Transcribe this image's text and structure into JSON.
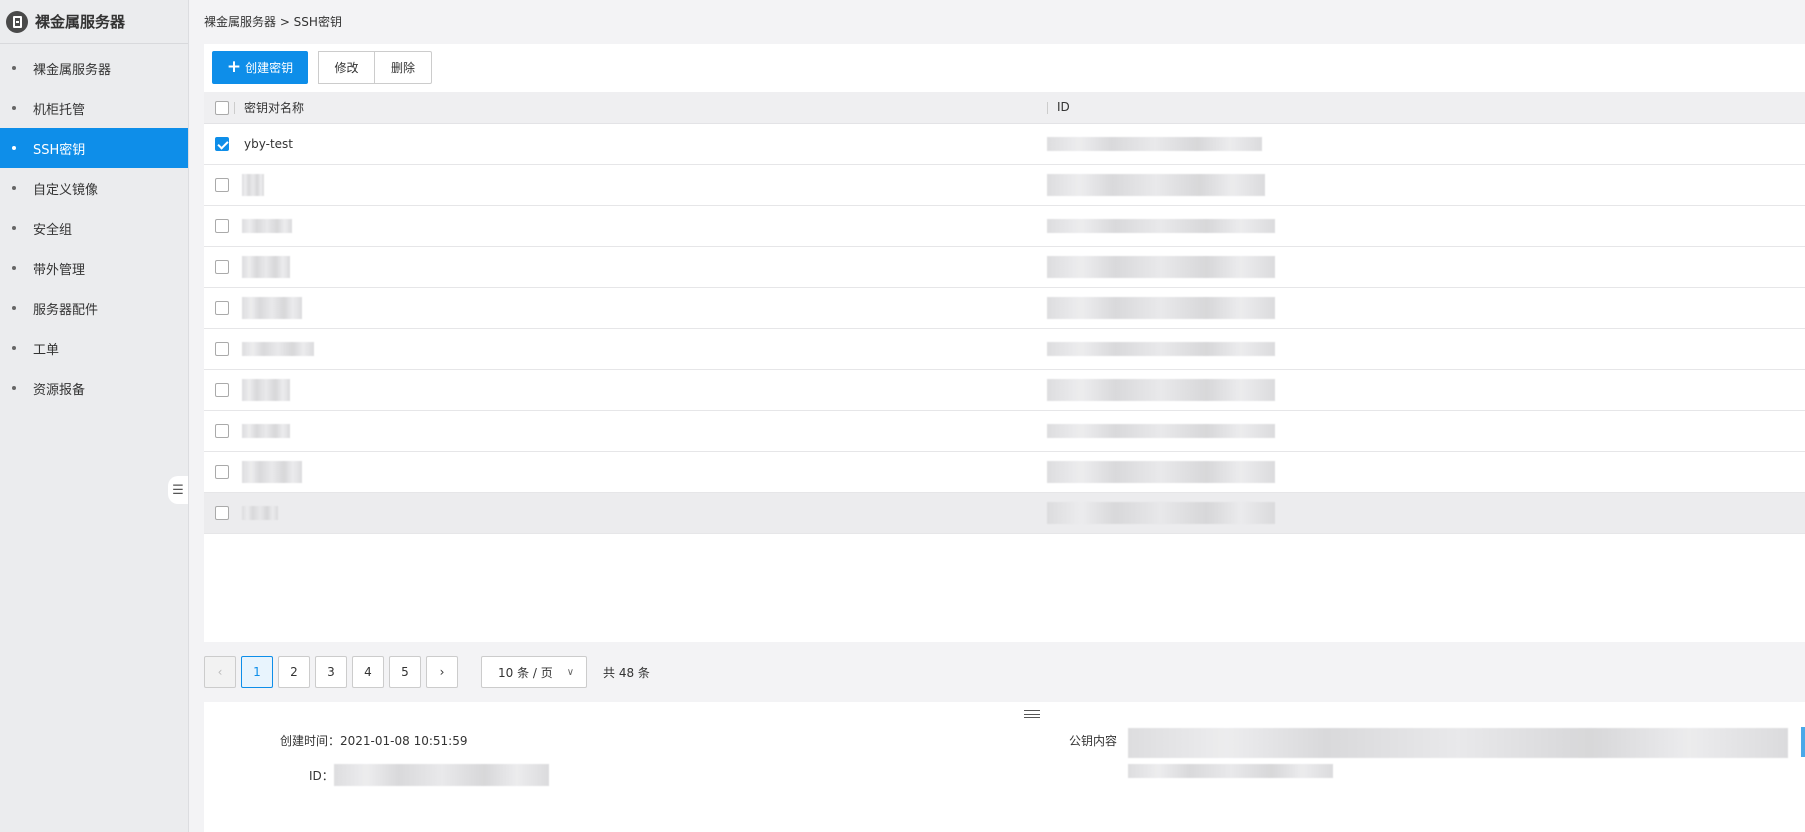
{
  "sidebar": {
    "title": "裸金属服务器",
    "items": [
      {
        "label": "裸金属服务器"
      },
      {
        "label": "机柜托管"
      },
      {
        "label": "SSH密钥"
      },
      {
        "label": "自定义镜像"
      },
      {
        "label": "安全组"
      },
      {
        "label": "带外管理"
      },
      {
        "label": "服务器配件"
      },
      {
        "label": "工单"
      },
      {
        "label": "资源报备"
      }
    ],
    "active_index": 2,
    "collapse_icon": "list-collapse-icon"
  },
  "breadcrumb": "裸金属服务器 > SSH密钥",
  "toolbar": {
    "create_label": "创建密钥",
    "edit_label": "修改",
    "delete_label": "删除"
  },
  "table": {
    "columns": [
      "密钥对名称",
      "ID"
    ],
    "rows": [
      {
        "name": "yby-test",
        "checked": true
      },
      {
        "name": "",
        "checked": false
      },
      {
        "name": "",
        "checked": false
      },
      {
        "name": "",
        "checked": false
      },
      {
        "name": "",
        "checked": false
      },
      {
        "name": "",
        "checked": false
      },
      {
        "name": "",
        "checked": false
      },
      {
        "name": "",
        "checked": false
      },
      {
        "name": "",
        "checked": false
      },
      {
        "name": "",
        "checked": false
      }
    ]
  },
  "pagination": {
    "prev_icon": "chevron-left-icon",
    "next_icon": "chevron-right-icon",
    "pages": [
      "1",
      "2",
      "3",
      "4",
      "5"
    ],
    "current": "1",
    "page_size": "10 条 / 页",
    "total": "共 48 条"
  },
  "detail": {
    "created_label": "创建时间：",
    "created_value": "2021-01-08 10:51:59",
    "id_label": "ID：",
    "pubkey_label": "公钥内容"
  },
  "colors": {
    "accent": "#0e8ee9",
    "sidebar_bg": "#ebecee"
  }
}
